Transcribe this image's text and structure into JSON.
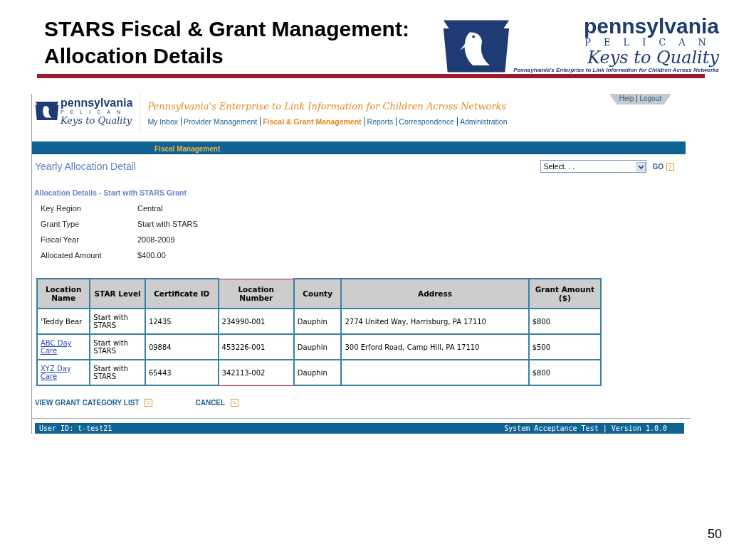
{
  "slide": {
    "title_lines": [
      "STARS Fiscal & Grant Management:",
      "Allocation Details"
    ],
    "logo": {
      "name": "pennsylvania",
      "sub": "PELICAN",
      "tagline": "Keys to Quality",
      "caption": "Pennsylvania's Enterprise to Link Information for Children Across Networks"
    },
    "page_number": "50"
  },
  "app": {
    "logo": {
      "name": "pennsylvania",
      "sub": "PELICAN",
      "tagline": "Keys to Quality"
    },
    "banner": "Pennsylvania's Enterprise to Link Information for Children Across Networks",
    "top_links": [
      "Help",
      "Logout"
    ],
    "nav": [
      {
        "label": "My Inbox",
        "selected": false
      },
      {
        "label": "Provider Management",
        "selected": false
      },
      {
        "label": "Fiscal & Grant Management",
        "selected": true
      },
      {
        "label": "Reports",
        "selected": false
      },
      {
        "label": "Correspondence",
        "selected": false
      },
      {
        "label": "Administration",
        "selected": false
      }
    ],
    "subnav": "Fiscal Management",
    "page_title": "Yearly Allocation Detail",
    "select": {
      "value": "Select. . ."
    },
    "go": "GO",
    "section_title": "Allocation Details - Start with STARS Grant",
    "details": [
      {
        "label": "Key Region",
        "value": "Central"
      },
      {
        "label": "Grant Type",
        "value": "Start with STARS"
      },
      {
        "label": "Fiscal Year",
        "value": "2008-2009"
      },
      {
        "label": "Allocated Amount",
        "value": "$400.00"
      }
    ],
    "table": {
      "columns": [
        {
          "label": "Location Name",
          "highlighted": false
        },
        {
          "label": "STAR Level",
          "highlighted": false
        },
        {
          "label": "Certificate ID",
          "highlighted": false
        },
        {
          "label": "Location Number",
          "highlighted": true
        },
        {
          "label": "County",
          "highlighted": false
        },
        {
          "label": "Address",
          "highlighted": false
        },
        {
          "label": "Grant Amount ($)",
          "highlighted": false
        }
      ],
      "rows": [
        {
          "link": false,
          "cells": [
            "'Teddy Bear",
            "Start with STARS",
            "12435",
            "234990-001",
            "Dauphin",
            "2774 United Way, Harrisburg, PA 17110",
            "$800"
          ]
        },
        {
          "link": true,
          "cells": [
            "ABC Day Care",
            "Start with STARS",
            "09884",
            "453226-001",
            "Dauphin",
            "300 Erford Road, Camp Hill, PA 17110",
            "$500"
          ]
        },
        {
          "link": true,
          "cells": [
            "XYZ Day Care",
            "Start with STARS",
            "65443",
            "342113-002",
            "Dauphin",
            "",
            "$800"
          ]
        }
      ]
    },
    "actions": [
      "VIEW GRANT CATEGORY LIST",
      "CANCEL"
    ],
    "status_bar": {
      "user": "User ID: t-test21",
      "version": "System Acceptance Test | Version 1.0.0"
    }
  }
}
